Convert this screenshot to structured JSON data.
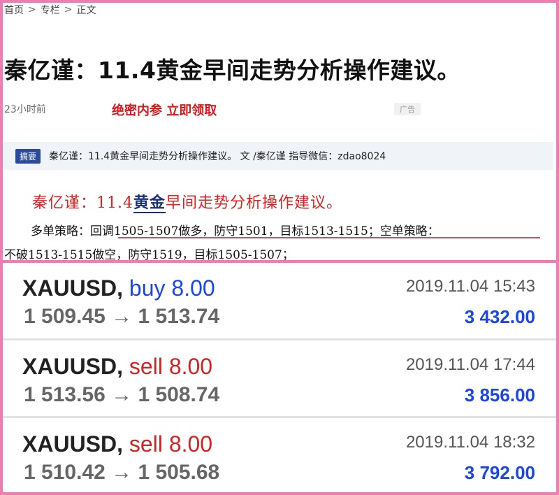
{
  "breadcrumb": {
    "home": "首页",
    "column": "专栏",
    "current": "正文",
    "separator": ">"
  },
  "article": {
    "title": "秦亿谨：11.4黄金早间走势分析操作建议。",
    "time": "23小时前",
    "promo": "绝密内参 立即领取",
    "ad_label": "广告",
    "summary_tag": "摘要",
    "summary_text": "秦亿谨：11.4黄金早间走势分析操作建议。 文 /秦亿谨 指导微信：zdao8024",
    "heading_pre": "秦亿谨：11.4",
    "heading_kw": "黄金",
    "heading_post": "早间走势分析操作建议。",
    "strategy_line1": "多单策略：回调1505-1507做多，防守1501，目标1513-1515；空单策略：",
    "strategy_line2": "不破1513-1515做空，防守1519，目标1505-1507；"
  },
  "trades": [
    {
      "symbol": "XAUUSD,",
      "side": "buy 8.00",
      "side_type": "buy",
      "prices": "1 509.45 → 1 513.74",
      "datetime": "2019.11.04 15:43",
      "profit": "3 432.00"
    },
    {
      "symbol": "XAUUSD,",
      "side": "sell 8.00",
      "side_type": "sell",
      "prices": "1 513.56 → 1 508.74",
      "datetime": "2019.11.04 17:44",
      "profit": "3 856.00"
    },
    {
      "symbol": "XAUUSD,",
      "side": "sell 8.00",
      "side_type": "sell",
      "prices": "1 510.42 → 1 505.68",
      "datetime": "2019.11.04 18:32",
      "profit": "3 792.00"
    }
  ],
  "colors": {
    "frame": "#f07cb0",
    "buy": "#1a46e8",
    "sell": "#d42222",
    "profit": "#1a46e8",
    "promo": "#d6191d"
  }
}
